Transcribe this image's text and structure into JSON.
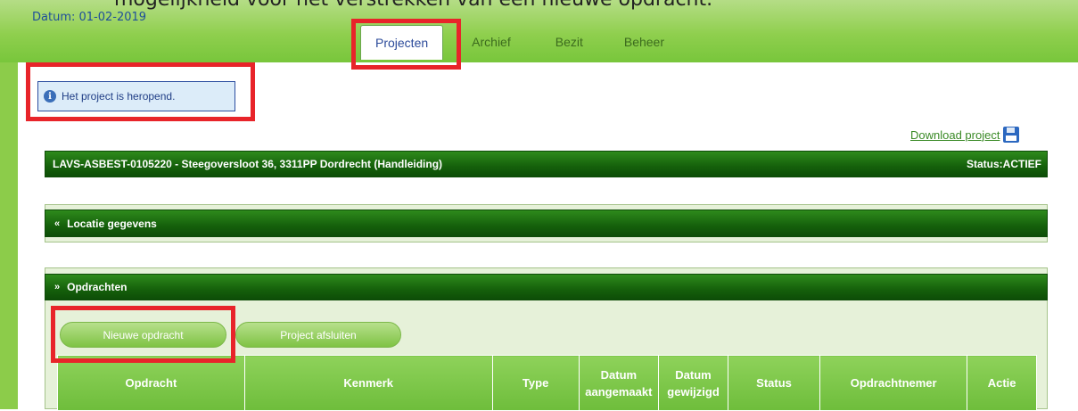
{
  "document": {
    "caption": "mogelijkheid voor het verstrekken van een nieuwe opdracht."
  },
  "header": {
    "date": "Datum: 01-02-2019",
    "tabs": [
      {
        "label": "Projecten",
        "active": true
      },
      {
        "label": "Archief",
        "active": false
      },
      {
        "label": "Bezit",
        "active": false
      },
      {
        "label": "Beheer",
        "active": false
      }
    ]
  },
  "notice": {
    "icon": "info-icon",
    "text": "Het project is heropend."
  },
  "download": {
    "label": "Download project",
    "icon": "floppy-disk-icon"
  },
  "project": {
    "title": "LAVS-ASBEST-0105220 - Steegoversloot 36, 3311PP Dordrecht (Handleiding)",
    "status": "Status:ACTIEF"
  },
  "sections": {
    "locatie": {
      "label": "Locatie gegevens",
      "icon": "chevron-double-up-icon"
    },
    "opdrachten": {
      "label": "Opdrachten",
      "icon": "chevron-double-down-icon"
    }
  },
  "buttons": {
    "new_assignment": "Nieuwe opdracht",
    "close_project": "Project afsluiten"
  },
  "table": {
    "columns": [
      "Opdracht",
      "Kenmerk",
      "Type",
      "Datum aangemaakt",
      "Datum gewijzigd",
      "Status",
      "Opdrachtnemer",
      "Actie"
    ]
  },
  "colors": {
    "header_green": "#8fcf4e",
    "bar_dark_green": "#15600b",
    "highlight_red": "#e8242a",
    "link_green": "#3a8a26"
  }
}
